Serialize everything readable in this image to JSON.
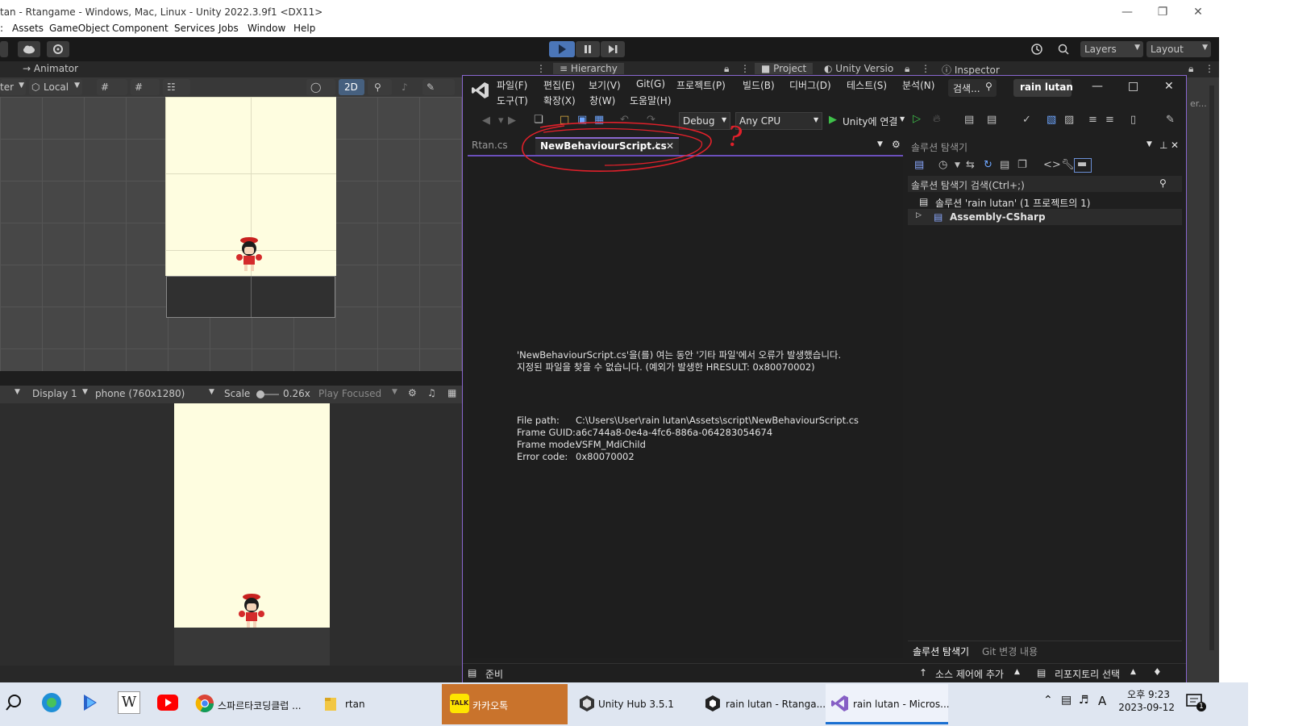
{
  "unity": {
    "title": "tan - Rtangame - Windows, Mac, Linux - Unity 2022.3.9f1 <DX11>",
    "menu": [
      "Assets",
      "GameObject",
      "Component",
      "Services",
      "Jobs",
      "Window",
      "Help"
    ],
    "toolbar": {
      "layers_label": "Layers",
      "layout_label": "Layout"
    },
    "tabs": {
      "animator": "Animator",
      "hierarchy": "Hierarchy",
      "project": "Project",
      "version": "Unity Versio",
      "inspector": "Inspector"
    },
    "scene_toolbar": {
      "pivot_partial": "ter",
      "local_label": "Local",
      "mode_2d": "2D"
    },
    "game_toolbar": {
      "display": "Display 1",
      "resolution": "phone (760x1280)",
      "scale_label": "Scale",
      "scale_value": "0.26x",
      "play_mode": "Play Focused"
    },
    "right_partial": "er..."
  },
  "vs": {
    "menu_row1": [
      "파일(F)",
      "편집(E)",
      "보기(V)",
      "Git(G)",
      "프로젝트(P)",
      "빌드(B)",
      "디버그(D)",
      "테스트(S)",
      "분석(N)"
    ],
    "menu_row2": [
      "도구(T)",
      "확장(X)",
      "창(W)",
      "도움말(H)"
    ],
    "search_label": "검색...",
    "solution_name": "rain lutan",
    "toolbar": {
      "config": "Debug",
      "platform": "Any CPU",
      "attach_label": "Unity에 연결"
    },
    "tabs": [
      {
        "label": "Rtan.cs",
        "active": false
      },
      {
        "label": "NewBehaviourScript.cs",
        "active": true
      }
    ],
    "error": {
      "line1": "'NewBehaviourScript.cs'을(를) 여는 동안 '기타 파일'에서 오류가 발생했습니다.",
      "line2": "지정된 파일을 찾을 수 없습니다. (예외가 발생한 HRESULT: 0x80070002)",
      "details": [
        {
          "key": "File path:",
          "value": "C:\\Users\\User\\rain lutan\\Assets\\script\\NewBehaviourScript.cs"
        },
        {
          "key": "Frame GUID:",
          "value": "a6c744a8-0e4a-4fc6-886a-064283054674"
        },
        {
          "key": "Frame mode:",
          "value": "VSFM_MdiChild"
        },
        {
          "key": "Error code:",
          "value": "0x80070002"
        }
      ]
    },
    "solution_explorer": {
      "title": "솔루션 탐색기",
      "search_placeholder": "솔루션 탐색기 검색(Ctrl+;)",
      "solution_node": "솔루션 'rain lutan' (1 프로젝트의 1)",
      "project_node": "Assembly-CSharp",
      "bottom_tabs": [
        "솔루션 탐색기",
        "Git 변경 내용"
      ]
    },
    "status": {
      "ready": "준비",
      "source_control": "소스 제어에 추가",
      "repository": "리포지토리 선택"
    }
  },
  "annotation": {
    "question_mark": "?"
  },
  "taskbar": {
    "items": [
      {
        "label": "스파르타코딩클럽 ...",
        "icon": "chrome-icon"
      },
      {
        "label": "rtan",
        "icon": "folder-icon"
      },
      {
        "label": "카카오톡",
        "icon": "kakaotalk-icon"
      },
      {
        "label": "Unity Hub 3.5.1",
        "icon": "unity-hub-icon"
      },
      {
        "label": "rain lutan - Rtanga...",
        "icon": "unity-icon"
      },
      {
        "label": "rain lutan - Micros...",
        "icon": "visual-studio-icon"
      }
    ],
    "ime": "A",
    "time": "오후 9:23",
    "date": "2023-09-12",
    "notification_count": "1"
  },
  "colors": {
    "vs_accent": "#8a67cf",
    "annotation_red": "#e0202a",
    "kakao_active": "#c9732c",
    "game_bg": "#fefde0"
  }
}
